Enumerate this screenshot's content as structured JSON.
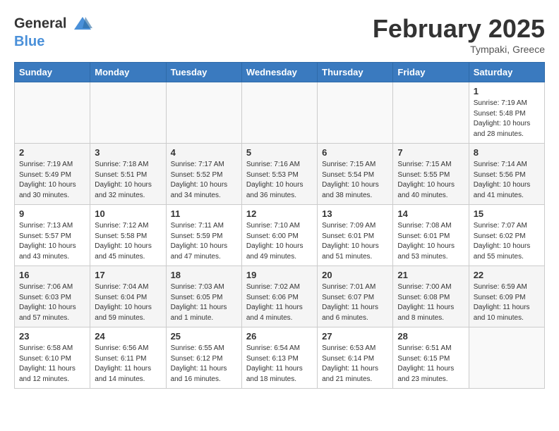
{
  "header": {
    "logo_general": "General",
    "logo_blue": "Blue",
    "month": "February 2025",
    "location": "Tympaki, Greece"
  },
  "weekdays": [
    "Sunday",
    "Monday",
    "Tuesday",
    "Wednesday",
    "Thursday",
    "Friday",
    "Saturday"
  ],
  "weeks": [
    [
      {
        "day": "",
        "info": ""
      },
      {
        "day": "",
        "info": ""
      },
      {
        "day": "",
        "info": ""
      },
      {
        "day": "",
        "info": ""
      },
      {
        "day": "",
        "info": ""
      },
      {
        "day": "",
        "info": ""
      },
      {
        "day": "1",
        "info": "Sunrise: 7:19 AM\nSunset: 5:48 PM\nDaylight: 10 hours and 28 minutes."
      }
    ],
    [
      {
        "day": "2",
        "info": "Sunrise: 7:19 AM\nSunset: 5:49 PM\nDaylight: 10 hours and 30 minutes."
      },
      {
        "day": "3",
        "info": "Sunrise: 7:18 AM\nSunset: 5:51 PM\nDaylight: 10 hours and 32 minutes."
      },
      {
        "day": "4",
        "info": "Sunrise: 7:17 AM\nSunset: 5:52 PM\nDaylight: 10 hours and 34 minutes."
      },
      {
        "day": "5",
        "info": "Sunrise: 7:16 AM\nSunset: 5:53 PM\nDaylight: 10 hours and 36 minutes."
      },
      {
        "day": "6",
        "info": "Sunrise: 7:15 AM\nSunset: 5:54 PM\nDaylight: 10 hours and 38 minutes."
      },
      {
        "day": "7",
        "info": "Sunrise: 7:15 AM\nSunset: 5:55 PM\nDaylight: 10 hours and 40 minutes."
      },
      {
        "day": "8",
        "info": "Sunrise: 7:14 AM\nSunset: 5:56 PM\nDaylight: 10 hours and 41 minutes."
      }
    ],
    [
      {
        "day": "9",
        "info": "Sunrise: 7:13 AM\nSunset: 5:57 PM\nDaylight: 10 hours and 43 minutes."
      },
      {
        "day": "10",
        "info": "Sunrise: 7:12 AM\nSunset: 5:58 PM\nDaylight: 10 hours and 45 minutes."
      },
      {
        "day": "11",
        "info": "Sunrise: 7:11 AM\nSunset: 5:59 PM\nDaylight: 10 hours and 47 minutes."
      },
      {
        "day": "12",
        "info": "Sunrise: 7:10 AM\nSunset: 6:00 PM\nDaylight: 10 hours and 49 minutes."
      },
      {
        "day": "13",
        "info": "Sunrise: 7:09 AM\nSunset: 6:01 PM\nDaylight: 10 hours and 51 minutes."
      },
      {
        "day": "14",
        "info": "Sunrise: 7:08 AM\nSunset: 6:01 PM\nDaylight: 10 hours and 53 minutes."
      },
      {
        "day": "15",
        "info": "Sunrise: 7:07 AM\nSunset: 6:02 PM\nDaylight: 10 hours and 55 minutes."
      }
    ],
    [
      {
        "day": "16",
        "info": "Sunrise: 7:06 AM\nSunset: 6:03 PM\nDaylight: 10 hours and 57 minutes."
      },
      {
        "day": "17",
        "info": "Sunrise: 7:04 AM\nSunset: 6:04 PM\nDaylight: 10 hours and 59 minutes."
      },
      {
        "day": "18",
        "info": "Sunrise: 7:03 AM\nSunset: 6:05 PM\nDaylight: 11 hours and 1 minute."
      },
      {
        "day": "19",
        "info": "Sunrise: 7:02 AM\nSunset: 6:06 PM\nDaylight: 11 hours and 4 minutes."
      },
      {
        "day": "20",
        "info": "Sunrise: 7:01 AM\nSunset: 6:07 PM\nDaylight: 11 hours and 6 minutes."
      },
      {
        "day": "21",
        "info": "Sunrise: 7:00 AM\nSunset: 6:08 PM\nDaylight: 11 hours and 8 minutes."
      },
      {
        "day": "22",
        "info": "Sunrise: 6:59 AM\nSunset: 6:09 PM\nDaylight: 11 hours and 10 minutes."
      }
    ],
    [
      {
        "day": "23",
        "info": "Sunrise: 6:58 AM\nSunset: 6:10 PM\nDaylight: 11 hours and 12 minutes."
      },
      {
        "day": "24",
        "info": "Sunrise: 6:56 AM\nSunset: 6:11 PM\nDaylight: 11 hours and 14 minutes."
      },
      {
        "day": "25",
        "info": "Sunrise: 6:55 AM\nSunset: 6:12 PM\nDaylight: 11 hours and 16 minutes."
      },
      {
        "day": "26",
        "info": "Sunrise: 6:54 AM\nSunset: 6:13 PM\nDaylight: 11 hours and 18 minutes."
      },
      {
        "day": "27",
        "info": "Sunrise: 6:53 AM\nSunset: 6:14 PM\nDaylight: 11 hours and 21 minutes."
      },
      {
        "day": "28",
        "info": "Sunrise: 6:51 AM\nSunset: 6:15 PM\nDaylight: 11 hours and 23 minutes."
      },
      {
        "day": "",
        "info": ""
      }
    ]
  ]
}
